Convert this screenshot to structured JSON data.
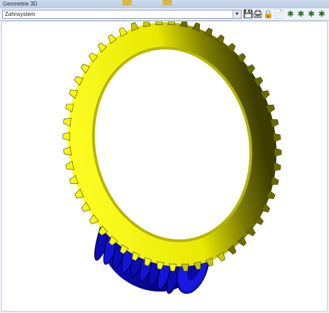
{
  "window": {
    "title": "Geometrie 3D"
  },
  "toolbar": {
    "combo_value": "Zahnsystem",
    "buttons": [
      {
        "name": "save-icon",
        "glyph": "💾"
      },
      {
        "name": "print-icon",
        "glyph": "🖨"
      },
      {
        "name": "lock-icon",
        "glyph": "🔒"
      },
      {
        "name": "export-icon",
        "glyph": "📄"
      },
      {
        "name": "view-icon",
        "glyph": "✱"
      },
      {
        "name": "view-front-icon",
        "glyph": "✱"
      },
      {
        "name": "view-side-icon",
        "glyph": "✱"
      },
      {
        "name": "view-top-icon",
        "glyph": "✱"
      }
    ]
  },
  "scene": {
    "gear_color": "#f2f200",
    "gear_shadow": "#4a4a00",
    "worm_color": "#1010e8",
    "worm_shadow": "#000060"
  }
}
